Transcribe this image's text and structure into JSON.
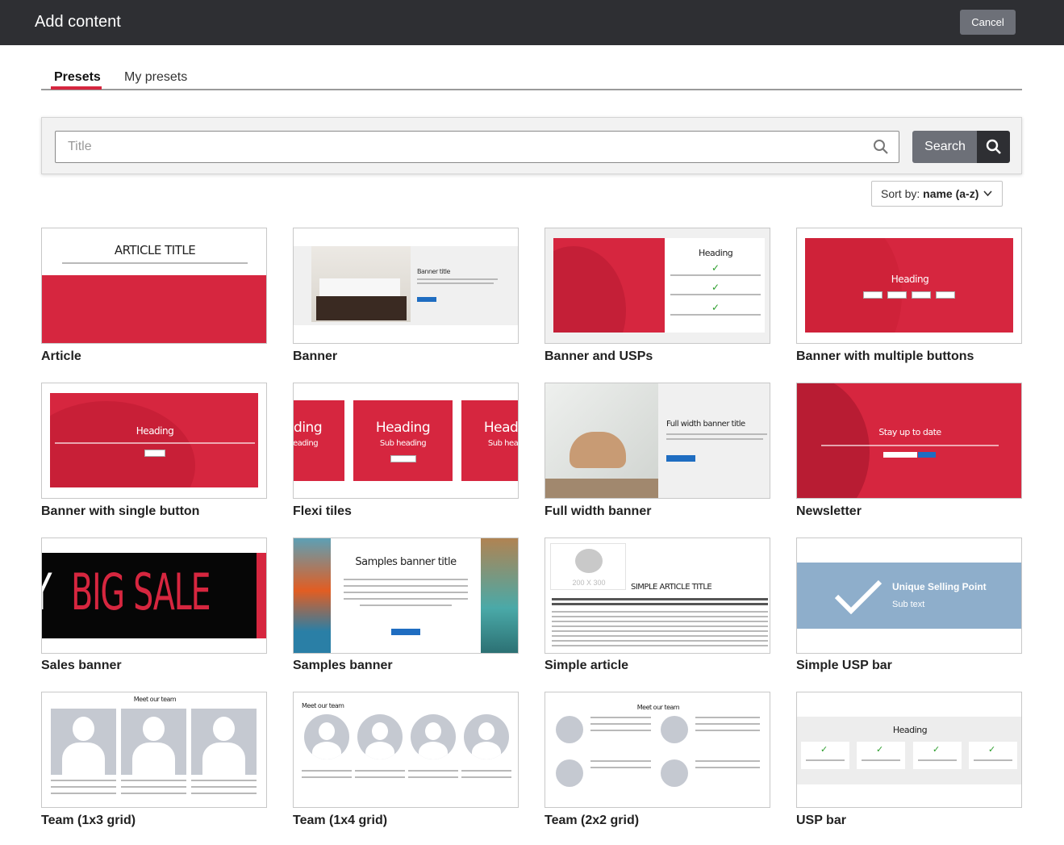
{
  "header": {
    "title": "Add content",
    "cancel_label": "Cancel"
  },
  "tabs": [
    {
      "label": "Presets",
      "active": true
    },
    {
      "label": "My presets",
      "active": false
    }
  ],
  "search": {
    "placeholder": "Title",
    "value": "",
    "button_label": "Search"
  },
  "sort": {
    "prefix": "Sort by:",
    "value": "name (a-z)"
  },
  "presets": [
    {
      "name": "Article",
      "preview_text": "ARTICLE TITLE"
    },
    {
      "name": "Banner",
      "preview_text": "Banner title"
    },
    {
      "name": "Banner and USPs",
      "preview_text": "Heading"
    },
    {
      "name": "Banner with multiple buttons",
      "preview_text": "Heading"
    },
    {
      "name": "Banner with single button",
      "preview_text": "Heading"
    },
    {
      "name": "Flexi tiles",
      "preview_text": "Heading",
      "preview_sub": "Sub heading"
    },
    {
      "name": "Full width banner",
      "preview_text": "Full width banner title"
    },
    {
      "name": "Newsletter",
      "preview_text": "Stay up to date"
    },
    {
      "name": "Sales banner",
      "preview_text": "BIG SALE"
    },
    {
      "name": "Samples banner",
      "preview_text": "Samples banner title"
    },
    {
      "name": "Simple article",
      "preview_text": "SIMPLE ARTICLE TITLE",
      "preview_sub": "200 X 300"
    },
    {
      "name": "Simple USP bar",
      "preview_text": "Unique Selling Point",
      "preview_sub": "Sub text"
    },
    {
      "name": "Team (1x3 grid)",
      "preview_text": "Meet our team"
    },
    {
      "name": "Team (1x4 grid)",
      "preview_text": "Meet our team"
    },
    {
      "name": "Team (2x2 grid)",
      "preview_text": "Meet our team"
    },
    {
      "name": "USP bar",
      "preview_text": "Heading"
    }
  ],
  "colors": {
    "accent": "#d6263f",
    "header_bg": "#2e2f33",
    "button_grey": "#6d7078",
    "usp_blue": "#8eaecb"
  }
}
